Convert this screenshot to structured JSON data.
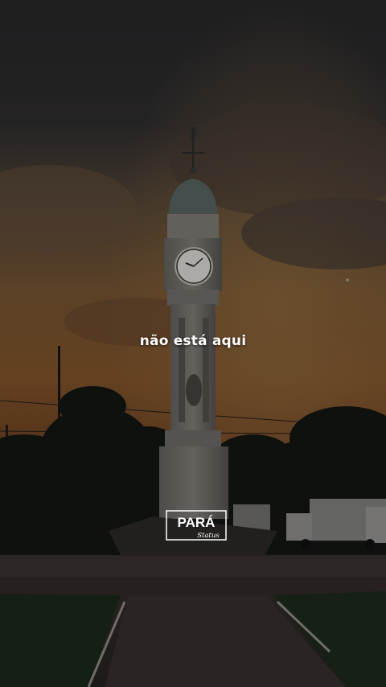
{
  "caption": "não está aqui",
  "watermark": {
    "title": "PARÁ",
    "subtitle": "Status"
  },
  "colors": {
    "sky_dark": "#2b2b2e",
    "sunset_orange": "#8a5a2c",
    "overlay": "#000000",
    "caption_text": "#ffffff"
  }
}
